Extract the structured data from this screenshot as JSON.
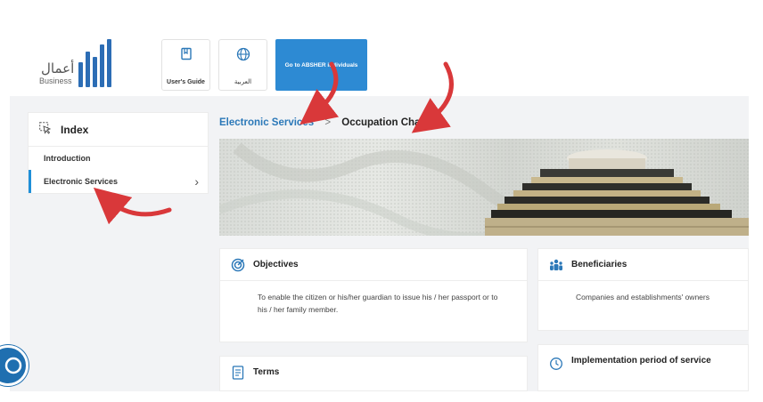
{
  "header": {
    "logo_ar": "أعمال",
    "logo_en": "Business",
    "users_guide_label": "User's Guide",
    "arabic_label": "العربية",
    "absher_label": "Go to ABSHER individuals"
  },
  "sidebar": {
    "title": "Index",
    "items": [
      {
        "label": "Introduction",
        "active": false
      },
      {
        "label": "Electronic Services",
        "active": true
      }
    ]
  },
  "breadcrumb": {
    "link": "Electronic Services",
    "separator": ">",
    "current": "Occupation Change"
  },
  "cards": {
    "objectives": {
      "title": "Objectives",
      "body": "To enable the citizen or his/her guardian to issue his / her passport or to his / her family member."
    },
    "beneficiaries": {
      "title": "Beneficiaries",
      "body": "Companies and establishments' owners"
    },
    "terms": {
      "title": "Terms"
    },
    "implementation": {
      "title": "Implementation period of service"
    }
  },
  "colors": {
    "accent": "#2d8ad3",
    "link": "#2b78b8",
    "annotation_arrow": "#d9383a"
  }
}
